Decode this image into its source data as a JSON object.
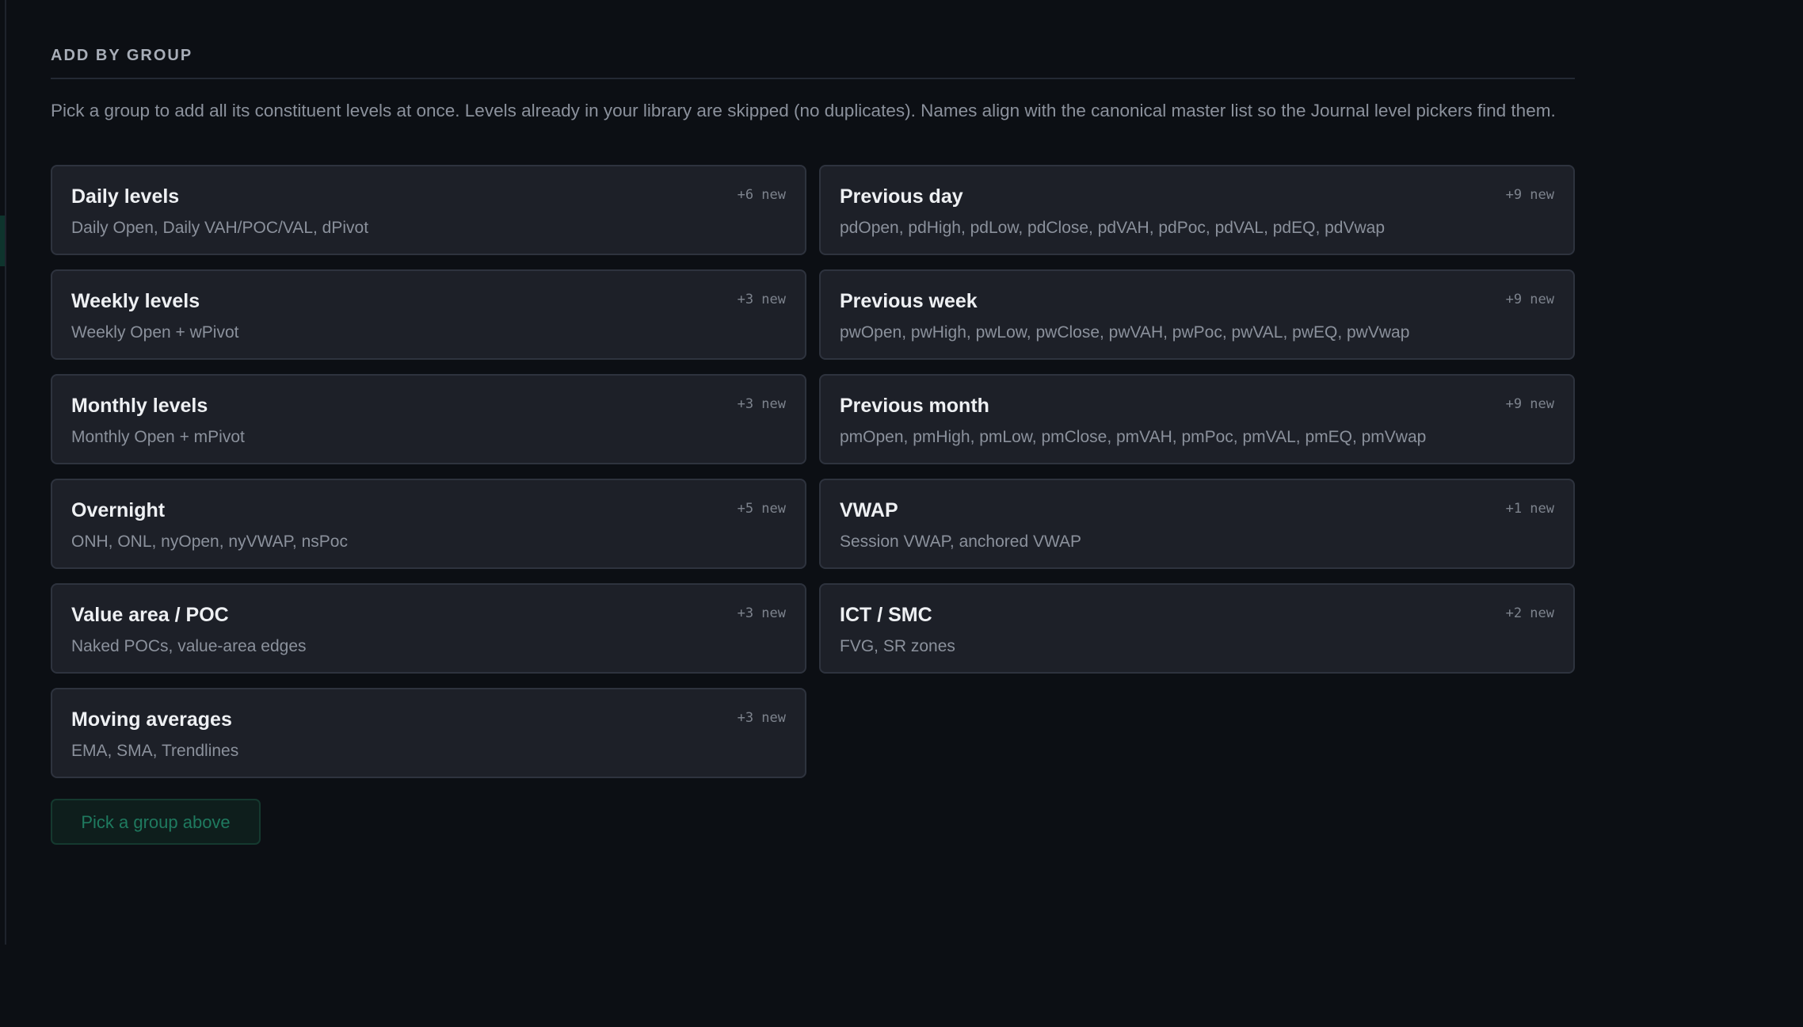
{
  "section": {
    "title": "ADD BY GROUP",
    "description": "Pick a group to add all its constituent levels at once. Levels already in your library are skipped (no duplicates). Names align with the canonical master list so the Journal level pickers find them."
  },
  "groups": [
    {
      "name": "Daily levels",
      "badge": "+6 new",
      "items": "Daily Open, Daily VAH/POC/VAL, dPivot"
    },
    {
      "name": "Previous day",
      "badge": "+9 new",
      "items": "pdOpen, pdHigh, pdLow, pdClose, pdVAH, pdPoc, pdVAL, pdEQ, pdVwap"
    },
    {
      "name": "Weekly levels",
      "badge": "+3 new",
      "items": "Weekly Open + wPivot"
    },
    {
      "name": "Previous week",
      "badge": "+9 new",
      "items": "pwOpen, pwHigh, pwLow, pwClose, pwVAH, pwPoc, pwVAL, pwEQ, pwVwap"
    },
    {
      "name": "Monthly levels",
      "badge": "+3 new",
      "items": "Monthly Open + mPivot"
    },
    {
      "name": "Previous month",
      "badge": "+9 new",
      "items": "pmOpen, pmHigh, pmLow, pmClose, pmVAH, pmPoc, pmVAL, pmEQ, pmVwap"
    },
    {
      "name": "Overnight",
      "badge": "+5 new",
      "items": "ONH, ONL, nyOpen, nyVWAP, nsPoc"
    },
    {
      "name": "VWAP",
      "badge": "+1 new",
      "items": "Session VWAP, anchored VWAP"
    },
    {
      "name": "Value area / POC",
      "badge": "+3 new",
      "items": "Naked POCs, value-area edges"
    },
    {
      "name": "ICT / SMC",
      "badge": "+2 new",
      "items": "FVG, SR zones"
    },
    {
      "name": "Moving averages",
      "badge": "+3 new",
      "items": "EMA, SMA, Trendlines"
    }
  ],
  "action": {
    "label": "Pick a group above"
  },
  "colors": {
    "background": "#0c0f14",
    "card": "#1d2028",
    "accent": "#1f7a5f"
  }
}
